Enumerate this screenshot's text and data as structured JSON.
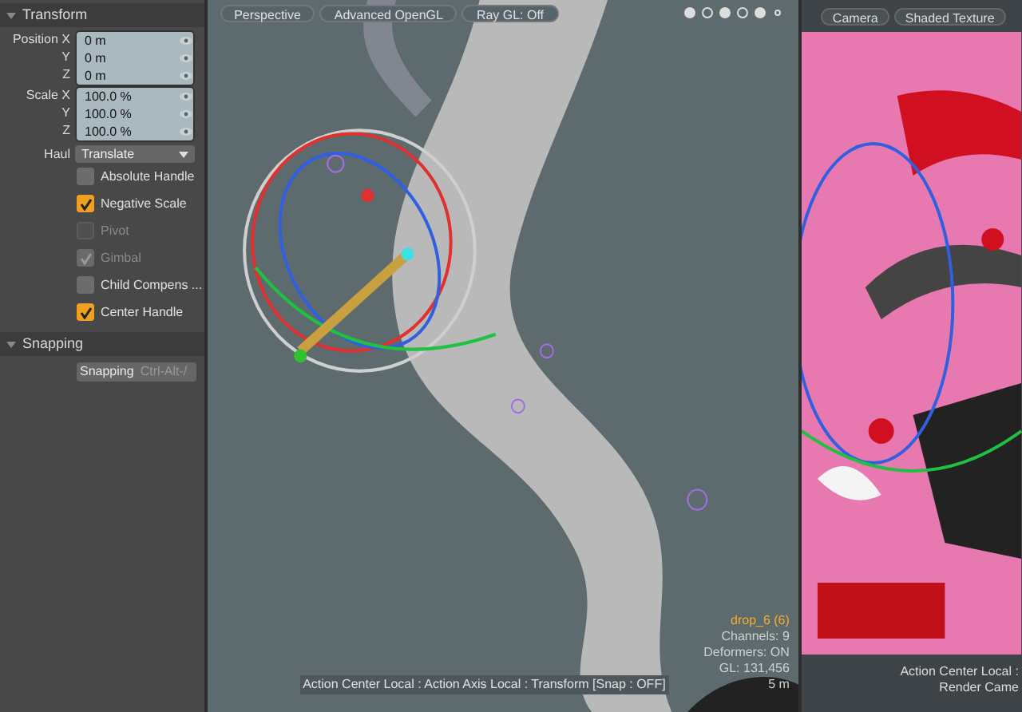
{
  "properties": {
    "sections": [
      {
        "title": "Transform",
        "expanded": true,
        "field_groups": [
          {
            "rows": [
              {
                "label": "Position X",
                "value": "0 m"
              },
              {
                "label": "Y",
                "value": "0 m"
              },
              {
                "label": "Z",
                "value": "0 m"
              }
            ]
          },
          {
            "rows": [
              {
                "label": "Scale X",
                "value": "100.0 %"
              },
              {
                "label": "Y",
                "value": "100.0 %"
              },
              {
                "label": "Z",
                "value": "100.0 %"
              }
            ]
          }
        ],
        "dropdown": {
          "label": "Haul",
          "value": "Translate"
        },
        "checkboxes": [
          {
            "label": "Absolute Handle",
            "checked": false,
            "disabled": false
          },
          {
            "label": "Negative Scale",
            "checked": true,
            "disabled": false
          },
          {
            "label": "Pivot",
            "checked": false,
            "disabled": true
          },
          {
            "label": "Gimbal",
            "checked": true,
            "disabled": true
          },
          {
            "label": "Child Compens ...",
            "checked": false,
            "disabled": false
          },
          {
            "label": "Center Handle",
            "checked": true,
            "disabled": false
          }
        ]
      },
      {
        "title": "Snapping",
        "expanded": true,
        "button": {
          "label": "Snapping",
          "shortcut": "Ctrl-Alt-/"
        }
      }
    ]
  },
  "viewport_main": {
    "tabs": [
      "Perspective",
      "Advanced OpenGL",
      "Ray GL: Off"
    ],
    "info": {
      "item": "drop_6 (6)",
      "lines": [
        "Channels: 9",
        "Deformers: ON",
        "GL: 131,456",
        "5 m"
      ]
    },
    "status": "Action Center Local : Action Axis Local : Transform [Snap : OFF]"
  },
  "viewport_camera": {
    "tabs": [
      "Camera",
      "Shaded Texture"
    ],
    "status": [
      "Action Center Local :",
      "Render Came"
    ]
  }
}
